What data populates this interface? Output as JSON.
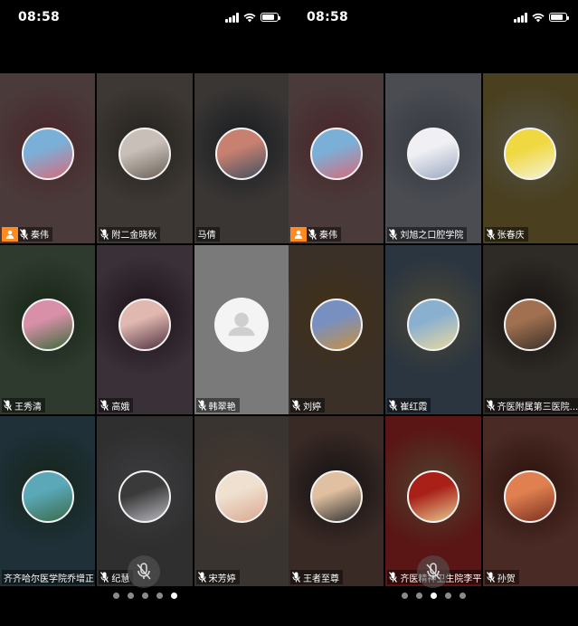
{
  "screens": [
    {
      "time": "08:58",
      "active_page": 5,
      "page_count": 5,
      "tiles": [
        {
          "name": "秦伟",
          "host": true,
          "mic": true,
          "bg": "#4a3a3a",
          "avatar": "family-photo",
          "colors": [
            "#7ab0d8",
            "#d86a7a"
          ]
        },
        {
          "name": "附二金晓秋",
          "host": false,
          "mic": true,
          "bg": "#3d3833",
          "avatar": "street-photo",
          "colors": [
            "#c8c0b8",
            "#6a6058"
          ]
        },
        {
          "name": "马倩",
          "host": false,
          "mic": false,
          "bg": "#3a3634",
          "avatar": "child-photo",
          "colors": [
            "#c88070",
            "#405060"
          ]
        },
        {
          "name": "王秀清",
          "host": false,
          "mic": true,
          "bg": "#2f3a2f",
          "avatar": "flower-photo",
          "colors": [
            "#d890a8",
            "#3a6a3a"
          ]
        },
        {
          "name": "高娥",
          "host": false,
          "mic": true,
          "bg": "#3a3038",
          "avatar": "girl-photo",
          "colors": [
            "#e0b8b0",
            "#503040"
          ]
        },
        {
          "name": "韩翠艳",
          "host": false,
          "mic": true,
          "bg": "#7a7a7a",
          "avatar": "default-user",
          "colors": [
            "#f4f4f4",
            "#cfcfcf"
          ]
        },
        {
          "name": "齐齐哈尔医学院乔增正",
          "host": false,
          "mic": false,
          "bg": "#1f3038",
          "avatar": "lake-photo",
          "colors": [
            "#5aa8b8",
            "#3a6a48"
          ]
        },
        {
          "name": "纪慧",
          "host": false,
          "mic": true,
          "bg": "#2f2f30",
          "avatar": "dark-photo",
          "colors": [
            "#3a3a3a",
            "#b8b8c0"
          ]
        },
        {
          "name": "宋芳婷",
          "host": false,
          "mic": true,
          "bg": "#3a3430",
          "avatar": "painting-photo",
          "colors": [
            "#f0e0d0",
            "#d8a890"
          ]
        }
      ]
    },
    {
      "time": "08:58",
      "active_page": 3,
      "page_count": 5,
      "tiles": [
        {
          "name": "秦伟",
          "host": true,
          "mic": true,
          "bg": "#4a3a3a",
          "avatar": "family-photo",
          "colors": [
            "#7ab0d8",
            "#d86a7a"
          ]
        },
        {
          "name": "刘旭之口腔学院",
          "host": false,
          "mic": true,
          "bg": "#4a4c52",
          "avatar": "doctor-photo",
          "colors": [
            "#f0f0f4",
            "#9aa8c0"
          ]
        },
        {
          "name": "张春庆",
          "host": false,
          "mic": true,
          "bg": "#4a4020",
          "avatar": "sponge-photo",
          "colors": [
            "#f0d840",
            "#f6f2d8"
          ]
        },
        {
          "name": "刘婷",
          "host": false,
          "mic": true,
          "bg": "#3a3028",
          "avatar": "castle-photo",
          "colors": [
            "#7890c0",
            "#c89040"
          ]
        },
        {
          "name": "崔红霞",
          "host": false,
          "mic": true,
          "bg": "#2a3540",
          "avatar": "woman-photo",
          "colors": [
            "#8ab0d0",
            "#e8d8a0"
          ]
        },
        {
          "name": "齐医附属第三医院...",
          "host": false,
          "mic": true,
          "bg": "#2e2a26",
          "avatar": "room-photo",
          "colors": [
            "#a07050",
            "#3a3028"
          ]
        },
        {
          "name": "王者至尊",
          "host": false,
          "mic": true,
          "bg": "#3a2a26",
          "avatar": "man-photo",
          "colors": [
            "#e0c0a0",
            "#303030"
          ]
        },
        {
          "name": "齐医精神卫生院李平",
          "host": false,
          "mic": true,
          "bg": "#5a1614",
          "avatar": "red-calligraphy",
          "colors": [
            "#a82018",
            "#e8c890"
          ]
        },
        {
          "name": "孙贺",
          "host": false,
          "mic": true,
          "bg": "#4a2a24",
          "avatar": "canyon-photo",
          "colors": [
            "#e08050",
            "#7a3020"
          ]
        }
      ]
    }
  ]
}
